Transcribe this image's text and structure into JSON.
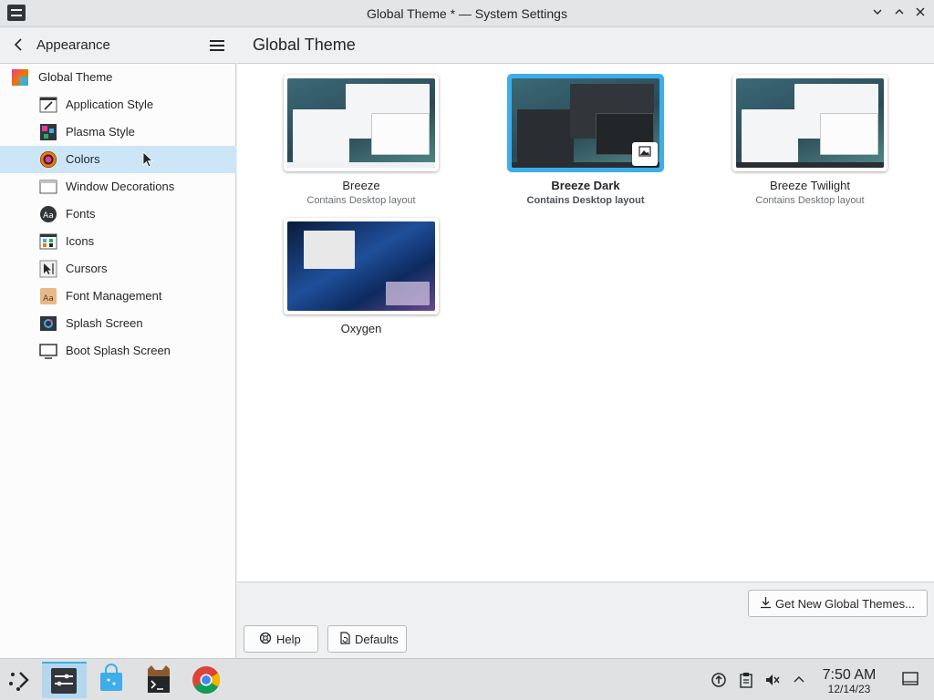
{
  "window": {
    "title": "Global Theme * — System Settings"
  },
  "sidebar": {
    "title": "Appearance",
    "items": [
      {
        "label": "Global Theme",
        "icon": "global-theme-icon"
      },
      {
        "label": "Application Style",
        "icon": "application-style-icon"
      },
      {
        "label": "Plasma Style",
        "icon": "plasma-style-icon"
      },
      {
        "label": "Colors",
        "icon": "colors-icon",
        "selected": true
      },
      {
        "label": "Window Decorations",
        "icon": "window-decorations-icon"
      },
      {
        "label": "Fonts",
        "icon": "fonts-icon"
      },
      {
        "label": "Icons",
        "icon": "icons-icon"
      },
      {
        "label": "Cursors",
        "icon": "cursors-icon"
      },
      {
        "label": "Font Management",
        "icon": "font-management-icon"
      },
      {
        "label": "Splash Screen",
        "icon": "splash-screen-icon"
      },
      {
        "label": "Boot Splash Screen",
        "icon": "boot-splash-screen-icon"
      }
    ]
  },
  "main": {
    "title": "Global Theme",
    "themes": [
      {
        "name": "Breeze",
        "desc": "Contains Desktop layout"
      },
      {
        "name": "Breeze Dark",
        "desc": "Contains Desktop layout",
        "selected": true
      },
      {
        "name": "Breeze Twilight",
        "desc": "Contains Desktop layout"
      },
      {
        "name": "Oxygen",
        "desc": ""
      }
    ],
    "get_new_label": "Get New Global Themes...",
    "help_label": "Help",
    "defaults_label": "Defaults"
  },
  "taskbar": {
    "items": [
      "application-launcher-icon",
      "system-settings-icon",
      "discover-icon",
      "terminal-icon",
      "chrome-icon"
    ],
    "tray": [
      "update-icon",
      "clipboard-icon",
      "volume-muted-icon",
      "chevron-up-icon"
    ],
    "time": "7:50 AM",
    "date": "12/14/23"
  },
  "colors": {
    "accent": "#3daee9",
    "selection": "#cde6f7"
  }
}
